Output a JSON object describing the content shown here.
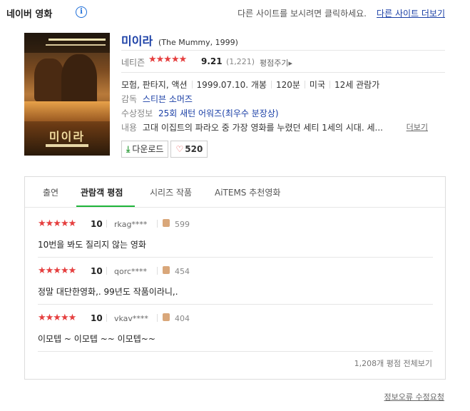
{
  "header": {
    "title": "네이버 영화",
    "info_icon": "i",
    "message": "다른 사이트를 보시려면 클릭하세요.",
    "other_site_link": "다른 사이트 더보기"
  },
  "movie": {
    "title": "미이라",
    "original_title": "(The Mummy, 1999)",
    "poster": {
      "logo_text": "미이라"
    },
    "rating": {
      "label": "네티즌",
      "stars": "★★★★★",
      "score": "9.21",
      "count": "(1,221)",
      "rate_link": "평점주기▸"
    },
    "genres": "모험, 판타지, 액션",
    "release": "1999.07.10. 개봉",
    "runtime": "120분",
    "country": "미국",
    "age": "12세 관람가",
    "director_label": "감독",
    "director": "스티븐 소머즈",
    "award_label": "수상정보",
    "award": "25회 새턴 어워즈(최우수 분장상)",
    "plot_label": "내용",
    "plot": "고대 이집트의 파라오 중 가장 영화를 누렸던 세티 1세의 시대. 세...",
    "plot_more": "더보기"
  },
  "buttons": {
    "download_icon": "⤓",
    "download": "다운로드",
    "heart_icon": "♡",
    "likes": "520"
  },
  "tabs": [
    {
      "label": "출연"
    },
    {
      "label": "관람객 평점"
    },
    {
      "label": "시리즈 작품"
    },
    {
      "label": "AiTEMS 추천영화"
    }
  ],
  "reviews": [
    {
      "stars": "★★★★★",
      "score": "10",
      "user": "rkag****",
      "likes": "599",
      "text": "10번을 봐도 질리지 않는 영화"
    },
    {
      "stars": "★★★★★",
      "score": "10",
      "user": "qorc****",
      "likes": "454",
      "text": "정말 대단한영화,. 99년도 작품이라니,."
    },
    {
      "stars": "★★★★★",
      "score": "10",
      "user": "vkav****",
      "likes": "404",
      "text": "이모텝 ~ 이모텝 ~~ 이모텝~~"
    }
  ],
  "panel_footer": "1,208개 평점 전체보기",
  "bottom_link": "정보오류 수정요청",
  "colors": {
    "accent_blue": "#1a3fa6",
    "star_red": "#e53f3f",
    "tab_green": "#1eb53a"
  }
}
